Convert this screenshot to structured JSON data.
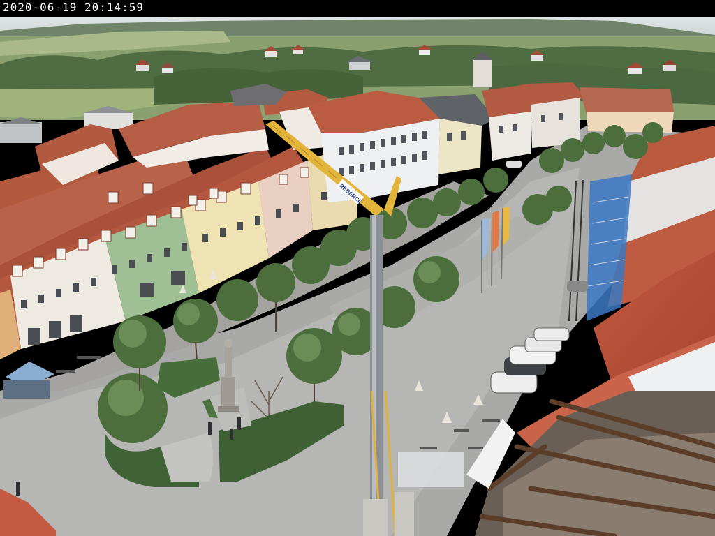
{
  "overlay": {
    "timestamp": "2020-06-19 20:14:59"
  },
  "banner_text": "REBERCE"
}
